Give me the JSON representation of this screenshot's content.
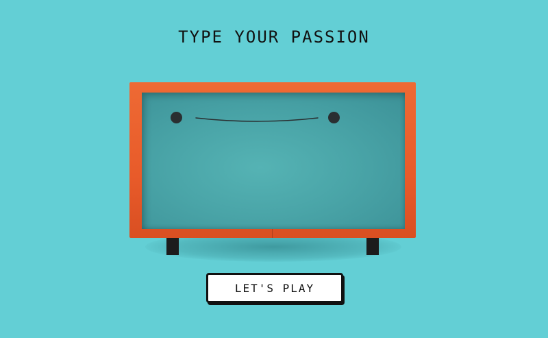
{
  "header": {
    "title": "TYPE YOUR PASSION"
  },
  "actions": {
    "play_label": "LET'S PLAY"
  },
  "colors": {
    "background": "#63cfd5",
    "cabinet": "#e85b2a",
    "screen": "#4aa5a8",
    "text": "#111111"
  }
}
